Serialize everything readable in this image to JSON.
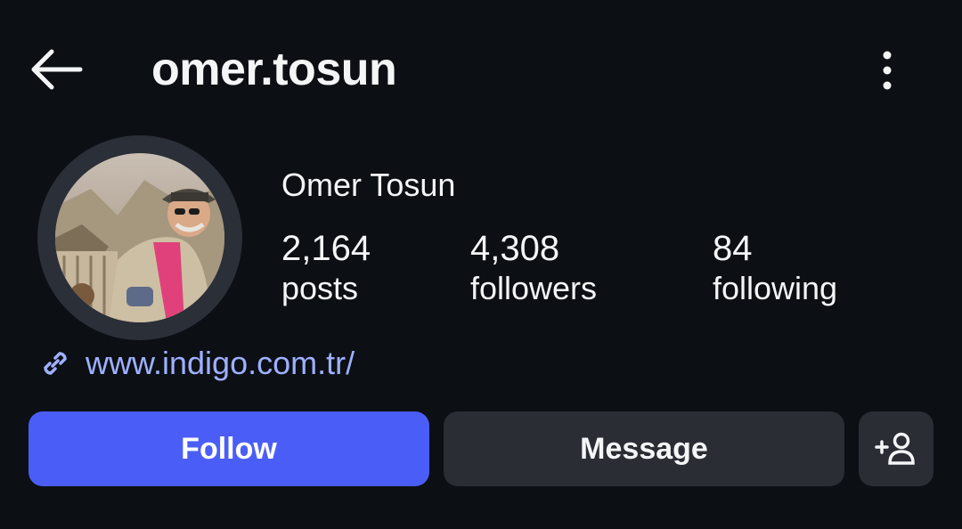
{
  "header": {
    "back_icon": "arrow-left-icon",
    "username": "omer.tosun",
    "more_icon": "vertical-ellipsis-icon"
  },
  "profile": {
    "full_name": "Omer Tosun",
    "avatar_description": "profile-photo",
    "stats": {
      "posts": {
        "value": "2,164",
        "label": "posts"
      },
      "followers": {
        "value": "4,308",
        "label": "followers"
      },
      "following": {
        "value": "84",
        "label": "following"
      }
    },
    "link": {
      "icon": "link-icon",
      "text": "www.indigo.com.tr/"
    }
  },
  "actions": {
    "follow_label": "Follow",
    "message_label": "Message",
    "add_user_icon": "add-person-icon"
  },
  "colors": {
    "background": "#0c0f14",
    "accent": "#4a5ef7",
    "secondary_button": "#2a2d34",
    "link": "#9eb0ff"
  }
}
